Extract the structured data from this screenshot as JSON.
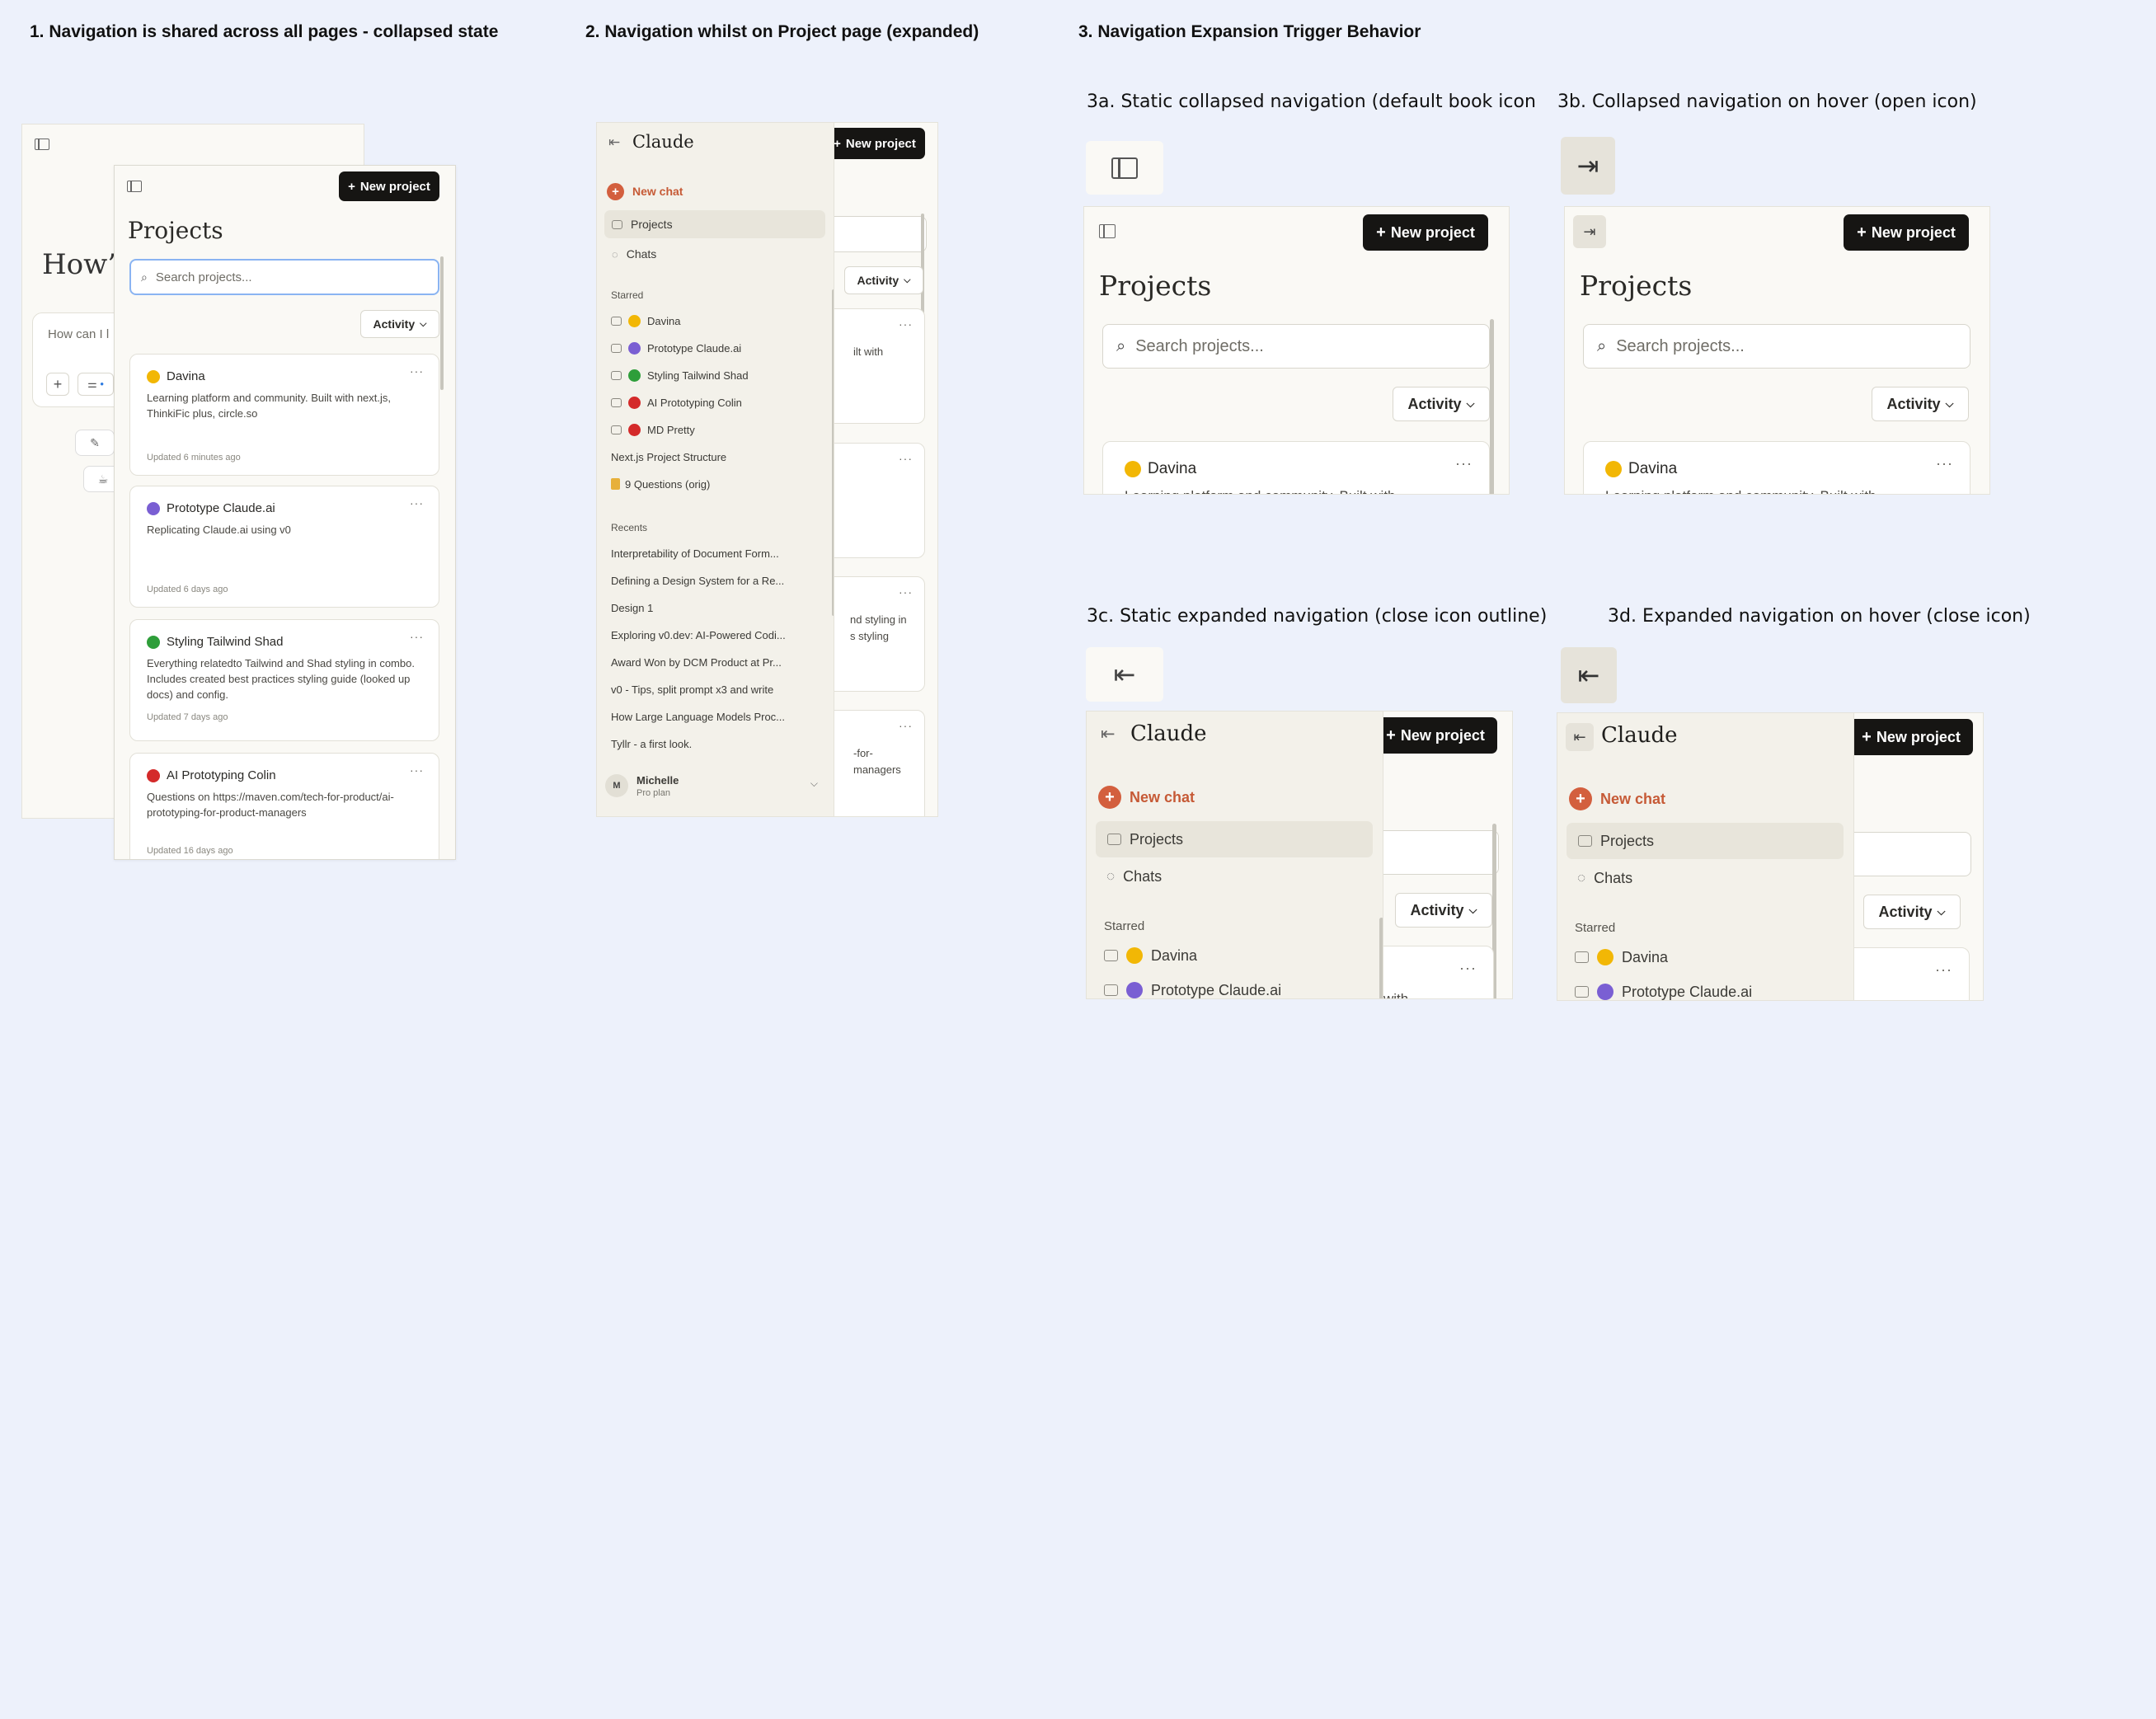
{
  "headings": {
    "h1": "1. Navigation is shared across all pages - collapsed state",
    "h2": "2. Navigation whilst on Project page (expanded)",
    "h3": "3. Navigation Expansion Trigger Behavior",
    "h3a": "3a. Static collapsed navigation (default book icon",
    "h3b": "3b. Collapsed navigation on hover (open icon)",
    "h3c": "3c. Static expanded navigation (close icon outline)",
    "h3d": "3d. Expanded navigation on hover (close icon)"
  },
  "brand": "Claude",
  "new_project": "New project",
  "projects_title": "Projects",
  "search_placeholder": "Search projects...",
  "activity": "Activity",
  "home_partial": {
    "greeting": "How’s",
    "input_placeholder": "How can I l"
  },
  "projects": [
    {
      "name": "Davina",
      "desc": "Learning platform and community. Built with next.js, ThinkiFic plus, circle.so",
      "updated": "Updated 6 minutes ago",
      "color": "#f2b705"
    },
    {
      "name": "Prototype Claude.ai",
      "desc": "Replicating Claude.ai using v0",
      "updated": "Updated 6 days ago",
      "color": "#7a5fd3"
    },
    {
      "name": "Styling Tailwind Shad",
      "desc": "Everything relatedto Tailwind and Shad styling in combo. Includes created best practices styling guide (looked up docs) and config.",
      "updated": "Updated 7 days ago",
      "color": "#2e9e3a"
    },
    {
      "name": "AI Prototyping Colin",
      "desc": "Questions on https://maven.com/tech-for-product/ai-prototyping-for-product-managers",
      "updated": "Updated 16 days ago",
      "color": "#d42a2a"
    }
  ],
  "partial_desc_3ab": "Learning platform and community. Built with",
  "nav": {
    "new_chat": "New chat",
    "projects": "Projects",
    "chats": "Chats",
    "starred_label": "Starred",
    "starred": [
      {
        "label": "Davina",
        "color": "#f2b705"
      },
      {
        "label": "Prototype Claude.ai",
        "color": "#7a5fd3"
      },
      {
        "label": "Styling Tailwind Shad",
        "color": "#2e9e3a"
      },
      {
        "label": "AI Prototyping Colin",
        "color": "#d42a2a"
      },
      {
        "label": "MD Pretty",
        "color": "#d42a2a"
      }
    ],
    "starred_plain": [
      "Next.js Project Structure",
      "9 Questions (orig)"
    ],
    "recents_label": "Recents",
    "recents": [
      "Interpretability of Document Form...",
      "Defining a Design System for a Re...",
      "Design 1",
      "Exploring v0.dev: AI-Powered Codi...",
      "Award Won by DCM Product at Pr...",
      "v0 - Tips, split prompt x3 and write",
      "How Large Language Models Proc...",
      "Tyllr - a first look."
    ],
    "user": {
      "initial": "M",
      "name": "Michelle",
      "plan": "Pro plan"
    }
  },
  "peek_text_2": {
    "card1": "ilt with",
    "card3a": "nd styling in",
    "card3b": "s styling",
    "card4a": "-for-",
    "card4b": "managers"
  },
  "peek_text_3": {
    "card1": "ilt with"
  },
  "colors": {
    "accent": "#d35f3e",
    "background": "#edf1fb",
    "panel": "#faf9f5",
    "sidebar": "#f3f1ea",
    "dark_button": "#161513"
  }
}
